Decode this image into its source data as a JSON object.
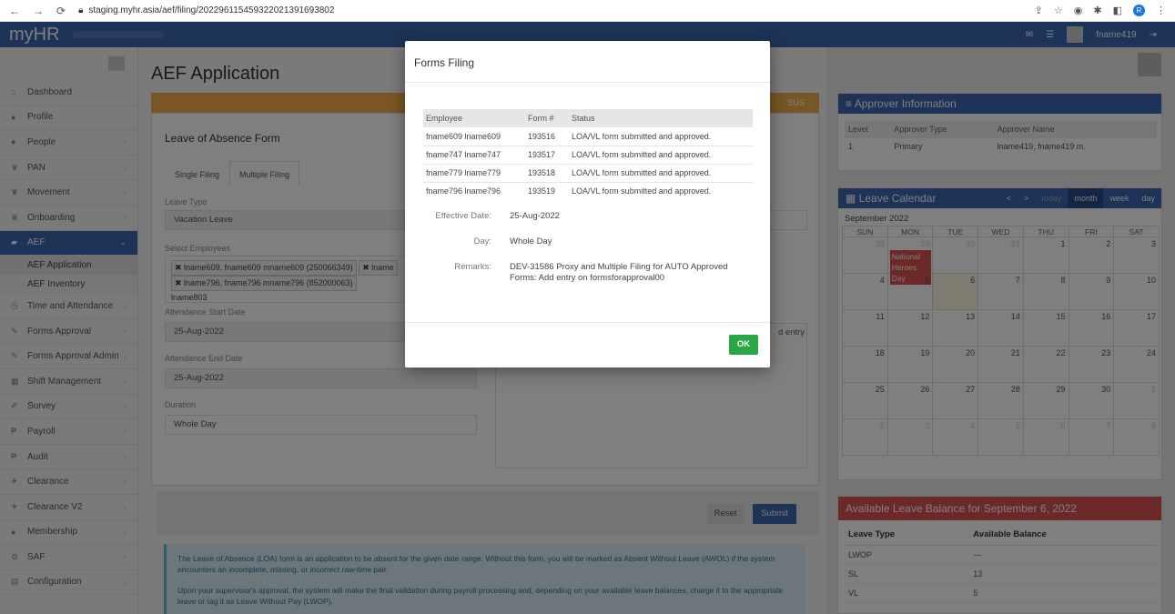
{
  "browser": {
    "url": "staging.myhr.asia/aef/filing/20229611545932202139169380​2",
    "profile_initial": "R"
  },
  "app": {
    "logo": "myHR",
    "username": "fname419"
  },
  "sidebar": {
    "items": [
      {
        "label": "Dashboard",
        "icon": "home-icon"
      },
      {
        "label": "Profile",
        "icon": "user-icon"
      },
      {
        "label": "People",
        "icon": "people-icon"
      },
      {
        "label": "PAN",
        "icon": "trophy-icon"
      },
      {
        "label": "Movement",
        "icon": "trophy-icon"
      },
      {
        "label": "Onboarding",
        "icon": "trophy-icon"
      },
      {
        "label": "AEF",
        "icon": "folder-icon"
      }
    ],
    "sub_items": [
      "AEF Application",
      "AEF Inventory"
    ],
    "items2": [
      {
        "label": "Time and Attendance",
        "icon": "clock-icon"
      },
      {
        "label": "Forms Approval",
        "icon": "pencil-icon"
      },
      {
        "label": "Forms Approval Admin",
        "icon": "pencil-icon"
      },
      {
        "label": "Shift Management",
        "icon": "calendar-icon"
      },
      {
        "label": "Survey",
        "icon": "edit-icon"
      },
      {
        "label": "Payroll",
        "icon": "peso-icon"
      },
      {
        "label": "Audit",
        "icon": "peso-icon"
      },
      {
        "label": "Clearance",
        "icon": "plane-icon"
      },
      {
        "label": "Clearance V2",
        "icon": "plane-icon"
      },
      {
        "label": "Membership",
        "icon": "people-icon"
      },
      {
        "label": "SAF",
        "icon": "gear-icon"
      },
      {
        "label": "Configuration",
        "icon": "config-icon"
      }
    ]
  },
  "main": {
    "title": "AEF Application",
    "warn_text": "SUS",
    "form_title": "Leave of Absence Form",
    "tabs": [
      "Single Filing",
      "Multiple Filing"
    ],
    "leave_type_label": "Leave Type",
    "leave_type_value": "Vacation Leave",
    "select_employees_label": "Select Employees",
    "chips": [
      "lname609, fname609 mname609 (250066349)",
      "lname",
      "lname796, fname796 mname796 (852000063)"
    ],
    "chip_tail": "lname803",
    "start_date_label": "Attendance Start Date",
    "start_date_value": "25-Aug-2022",
    "end_date_label": "Attendance End Date",
    "end_date_value": "25-Aug-2022",
    "duration_label": "Duration",
    "duration_value": "Whole Day",
    "remarks_partial": "d entry",
    "reset_label": "Reset",
    "submit_label": "Submit",
    "info_p1": "The Leave of Absence (LOA) form is an application to be absent for the given date range. Without this form, you will be marked as Absent Without Leave (AWOL) if the system encounters an incomplete, missing, or incorrect raw-time pair.",
    "info_p2": "Upon your supervisor's approval, the system will make the final validation during payroll processing and, depending on your available leave balances, charge it to the appropriate leave or tag it as Leave Without Pay (LWOP)."
  },
  "approver": {
    "title": "Approver Information",
    "headers": [
      "Level",
      "Approver Type",
      "Approver Name"
    ],
    "rows": [
      [
        "1",
        "Primary",
        "lname419, fname419 m."
      ]
    ]
  },
  "calendar": {
    "title": "Leave Calendar",
    "controls": [
      "<",
      ">",
      "today",
      "month",
      "week",
      "day"
    ],
    "month_label": "September 2022",
    "days": [
      "SUN",
      "MON",
      "TUE",
      "WED",
      "THU",
      "FRI",
      "SAT"
    ],
    "weeks": [
      [
        "28",
        "29",
        "30",
        "31",
        "1",
        "2",
        "3"
      ],
      [
        "4",
        "5",
        "6",
        "7",
        "8",
        "9",
        "10"
      ],
      [
        "11",
        "12",
        "13",
        "14",
        "15",
        "16",
        "17"
      ],
      [
        "18",
        "19",
        "20",
        "21",
        "22",
        "23",
        "24"
      ],
      [
        "25",
        "26",
        "27",
        "28",
        "29",
        "30",
        "1"
      ],
      [
        "2",
        "3",
        "4",
        "5",
        "6",
        "7",
        "8"
      ]
    ],
    "event": "National Heroes Day"
  },
  "balance": {
    "title": "Available Leave Balance for September 6, 2022",
    "headers": [
      "Leave Type",
      "Available Balance"
    ],
    "rows": [
      [
        "LWOP",
        "---"
      ],
      [
        "SL",
        "13"
      ],
      [
        "VL",
        "5"
      ]
    ]
  },
  "modal": {
    "title": "Forms Filing",
    "headers": [
      "Employee",
      "Form #",
      "Status"
    ],
    "rows": [
      [
        "fname609 lname609",
        "193516",
        "LOA/VL form submitted and approved."
      ],
      [
        "fname747 lname747",
        "193517",
        "LOA/VL form submitted and approved."
      ],
      [
        "fname779 lname779",
        "193518",
        "LOA/VL form submitted and approved."
      ],
      [
        "fname796 lname796",
        "193519",
        "LOA/VL form submitted and approved."
      ]
    ],
    "effective_label": "Effective Date:",
    "effective_value": "25-Aug-2022",
    "day_label": "Day:",
    "day_value": "Whole Day",
    "remarks_label": "Remarks:",
    "remarks_value": "DEV-31586 Proxy and Multiple Filing for AUTO Approved Forms: Add entry on formsforapproval00",
    "ok_label": "OK"
  }
}
